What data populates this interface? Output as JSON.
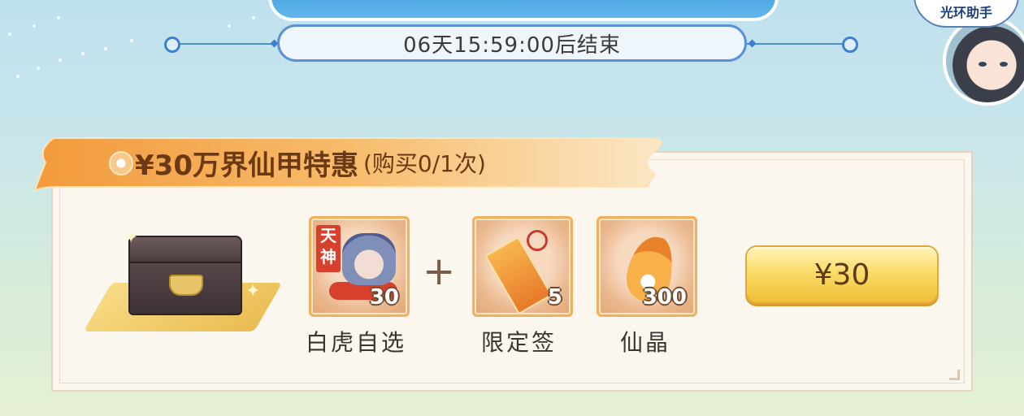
{
  "event": {
    "countdown_text": "06天15:59:00后结束"
  },
  "helper": {
    "badge_label": "光环助手"
  },
  "offer": {
    "title": "¥30万界仙甲特惠",
    "purchase_limit": "(购买0/1次)",
    "price_label": "¥30",
    "items": [
      {
        "icon": "hero-selector-icon",
        "tag": "天神",
        "quantity": "30",
        "label": "白虎自选"
      },
      {
        "icon": "talisman-icon",
        "quantity": "5",
        "label": "限定签"
      },
      {
        "icon": "crystal-icon",
        "quantity": "300",
        "label": "仙晶"
      }
    ],
    "plus_symbol": "+"
  },
  "colors": {
    "ribbon": "#f2a14a",
    "button": "#fbdc6a",
    "timeline": "#4f8fd6"
  }
}
